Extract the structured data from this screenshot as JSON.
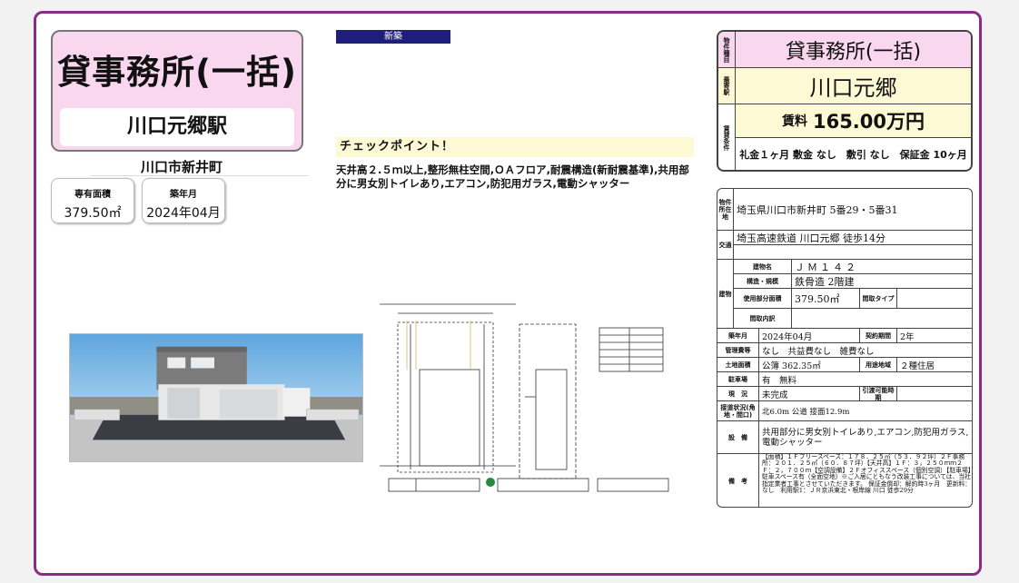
{
  "listing": {
    "type": "貸事務所(一括)",
    "station": "川口元郷駅",
    "town": "川口市新井町",
    "area_label": "専有面積",
    "area_value": "379.50㎡",
    "built_label": "築年月",
    "built_value": "2024年04月",
    "new_badge": "新築"
  },
  "checkpoint": {
    "heading": "チェックポイント！",
    "text": "天井高２.５ｍ以上,整形無柱空間,ＯＡフロア,耐震構造(新耐震基準),共用部分に男女別トイレあり,エアコン,防犯用ガラス,電動シャッター"
  },
  "summary": {
    "type_head": "物件種目",
    "type_value": "貸事務所(一括)",
    "station_head": "最寄駅",
    "station_value": "川口元郷",
    "terms_head": "賃貸条件",
    "rent_label": "賃料",
    "rent_value": "165.00万円",
    "terms_value": "礼金１ヶ月 敷金 なし　敷引 なし　保証金 10ヶ月"
  },
  "details": {
    "location_head": "物件所在地",
    "location": "埼玉県川口市新井町 5番29・5番31",
    "transport_head": "交通",
    "transport": "埼玉高速鉄道 川口元郷 徒歩14分",
    "building_head": "建物",
    "name_label": "建物名",
    "name": "ＪＭ１４２",
    "structure_label": "構造・規模",
    "structure": "鉄骨造 2階建",
    "area_label": "使用部分面積",
    "area": "379.50㎡",
    "layout_type_label": "間取タイプ",
    "layout_label": "間取内訳",
    "built_label": "築年月",
    "built": "2024年04月",
    "contract_label": "契約期間",
    "contract": "2年",
    "mgmt_label": "管理費等",
    "mgmt": "なし　共益費なし　雑費なし",
    "land_label": "土地面積",
    "land": "公簿 362.35㎡",
    "zone_label": "用途地域",
    "zone": "２種住居",
    "parking_label": "駐車場",
    "parking": "有　無料",
    "status_label": "現　況",
    "status": "未完成",
    "handover_label": "引渡可能時期",
    "road_label": "接道状況(角地・間口)",
    "road": "北6.0m 公道 接面12.9m",
    "equip_label": "設　備",
    "equip": "共用部分に男女別トイレあり,エアコン,防犯用ガラス,電動シャッター",
    "remarks_label": "備　考",
    "remarks": "【面積】１Ｆフリースペース：１７８．２５㎡（５３．９２坪）２Ｆ事務所：２０１．２５㎡（６０．８７坪）【天井高】１Ｆ：３，２５０ｍｍ２Ｆ：２，７００ｍ【空調設備】２Ｆオフィススペース（個別空調）【駐車場】駐車スペース有（全面空地）※ご入居にともなう改装工事については、当社指定業者工事とさせていただきます。 保証金償却：解約時3ヶ月　更新料：なし　利用駅1：ＪＲ京浜東北・根岸線 川口 徒歩29分"
  },
  "colors": {
    "frame": "#8a2b86",
    "title_bg": "#f8d7ef",
    "rent_bg": "#fdf9d4",
    "badge": "#1f1f7a"
  },
  "images": {
    "photo": "building-exterior-render",
    "plan": "floor-plan-drawing"
  }
}
